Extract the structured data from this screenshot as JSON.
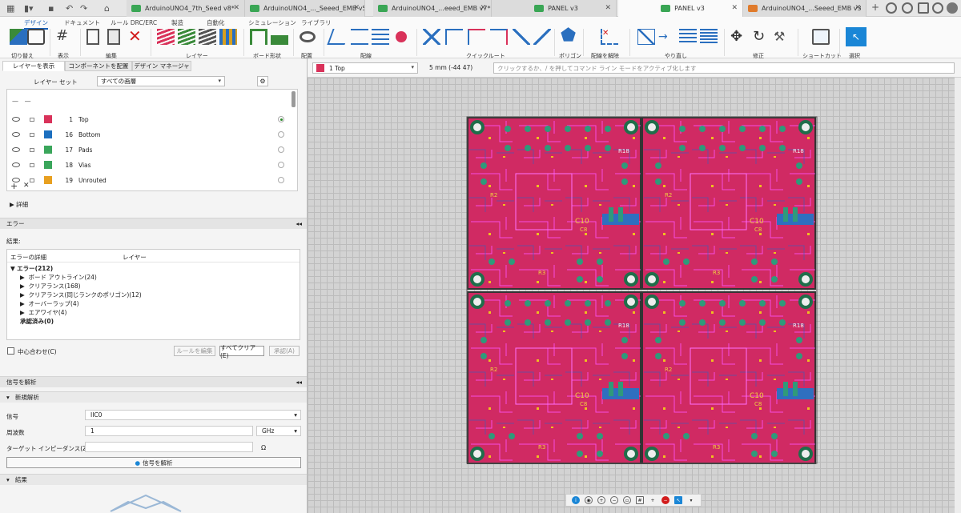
{
  "tabs": [
    {
      "label": "ArduinoUNO4_7th_Seed v8*",
      "color": "#3aa655"
    },
    {
      "label": "ArduinoUNO4_..._Seeed_EMB v5",
      "color": "#3aa655"
    },
    {
      "label": "ArduinoUNO4_...eeed_EMB v7*",
      "color": "#3aa655"
    },
    {
      "label": "PANEL v3",
      "color": "#3aa655"
    },
    {
      "label": "PANEL v3",
      "color": "#3aa655"
    },
    {
      "label": "ArduinoUNO4_...Seeed_EMB v3",
      "color": "#e07b2c"
    }
  ],
  "ribbon": {
    "tabs": [
      "デザイン",
      "ドキュメント",
      "ルール DRC/ERC",
      "製造",
      "自動化",
      "シミュレーション",
      "ライブラリ"
    ],
    "groups": [
      "切り替え",
      "表示",
      "編集",
      "レイヤー",
      "ボード形状",
      "配置",
      "配線",
      "クイックルート",
      "ポリゴン",
      "配線を解除",
      "やり直し",
      "修正",
      "ショートカット",
      "選択"
    ]
  },
  "panel": {
    "tabs": [
      "レイヤーを表示",
      "コンポーネントを配置",
      "デザイン マネージャ"
    ],
    "layer_set_label": "レイヤー セット",
    "layer_set_value": "すべての画層",
    "layers": [
      {
        "num": "1",
        "name": "Top",
        "color": "#d9325a"
      },
      {
        "num": "16",
        "name": "Bottom",
        "color": "#1c6fbf"
      },
      {
        "num": "17",
        "name": "Pads",
        "color": "#3aa65b"
      },
      {
        "num": "18",
        "name": "Vias",
        "color": "#3aa65b"
      },
      {
        "num": "19",
        "name": "Unrouted",
        "color": "#e8a020"
      }
    ],
    "details": "詳細",
    "error_header": "エラー",
    "result_label": "結果:",
    "col_detail": "エラーの詳細",
    "col_layer": "レイヤー",
    "errors_root": "エラー(212)",
    "error_items": [
      "ボード アウトライン(24)",
      "クリアランス(168)",
      "クリアランス(同じランクのポリゴン)(12)",
      "オーバーラップ(4)",
      "エアワイヤ(4)"
    ],
    "approved": "承認済み(0)",
    "center_label": "中心合わせ(C)",
    "btn_rule": "ルールを編集",
    "btn_clear": "すべてクリア(E)",
    "btn_approve": "承認(A)",
    "signal_header": "信号を解析",
    "new_analysis": "新規解析",
    "signal_label": "信号",
    "signal_value": "IIC0",
    "freq_label": "周波数",
    "freq_value": "1",
    "freq_unit": "GHz",
    "imp_label": "ターゲット インピーダンス(Z0)",
    "imp_unit": "Ω",
    "analyze_btn": "信号を解析",
    "results": "結果"
  },
  "cmd": {
    "layer": "1 Top",
    "coord": "5 mm (-44 47)",
    "placeholder": "クリックするか、/ を押してコマンド ライン モードをアクティブ化します"
  },
  "board": {
    "labels": [
      "R18",
      "R2",
      "C10",
      "C8",
      "R3"
    ]
  }
}
